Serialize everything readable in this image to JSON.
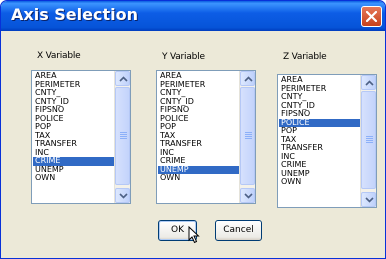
{
  "window": {
    "title": "Axis Selection"
  },
  "columns": [
    {
      "label": "X Variable",
      "items": [
        "AREA",
        "PERIMETER",
        "CNTY_",
        "CNTY_ID",
        "FIPSNO",
        "POLICE",
        "POP",
        "TAX",
        "TRANSFER",
        "INC",
        "CRIME",
        "UNEMP",
        "OWN"
      ],
      "selected": "CRIME"
    },
    {
      "label": "Y Variable",
      "items": [
        "AREA",
        "PERIMETER",
        "CNTY_",
        "CNTY_ID",
        "FIPSNO",
        "POLICE",
        "POP",
        "TAX",
        "TRANSFER",
        "INC",
        "CRIME",
        "UNEMP",
        "OWN"
      ],
      "selected": "UNEMP"
    },
    {
      "label": "Z Variable",
      "items": [
        "AREA",
        "PERIMETER",
        "CNTY_",
        "CNTY_ID",
        "FIPSNO",
        "POLICE",
        "POP",
        "TAX",
        "TRANSFER",
        "INC",
        "CRIME",
        "UNEMP",
        "OWN"
      ],
      "selected": "POLICE"
    }
  ],
  "buttons": {
    "ok": "OK",
    "cancel": "Cancel"
  },
  "colors": {
    "titlebar": "#0654d8",
    "selection": "#316ac5",
    "dialog_bg": "#ece9d8"
  }
}
